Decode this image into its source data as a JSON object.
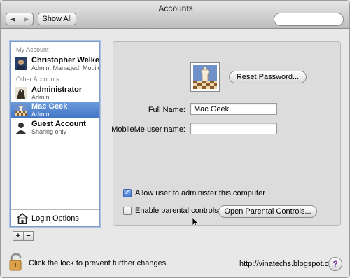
{
  "window": {
    "title": "Accounts"
  },
  "toolbar": {
    "back_icon": "◀",
    "forward_icon": "▶",
    "show_all_label": "Show All"
  },
  "sidebar": {
    "my_account_label": "My Account",
    "other_accounts_label": "Other Accounts",
    "accounts": [
      {
        "name": "Christopher Welker",
        "sub": "Admin, Managed, Mobile"
      },
      {
        "name": "Administrator",
        "sub": "Admin"
      },
      {
        "name": "Mac Geek",
        "sub": "Admin"
      },
      {
        "name": "Guest Account",
        "sub": "Sharing only"
      }
    ],
    "selected": "Mac Geek",
    "login_options_label": "Login Options",
    "add_label": "+",
    "remove_label": "−"
  },
  "panel": {
    "reset_password_label": "Reset Password...",
    "full_name_label": "Full Name:",
    "full_name_value": "Mac Geek",
    "mobileme_label": "MobileMe user name:",
    "mobileme_value": "",
    "allow_admin_label": "Allow user to administer this computer",
    "allow_admin_checked": true,
    "parental_label": "Enable parental controls",
    "parental_checked": false,
    "open_parental_label": "Open Parental Controls..."
  },
  "footer": {
    "lock_text": "Click the lock to prevent further changes.",
    "watermark": "http://vinatechs.blogspot.com",
    "help_label": "?"
  },
  "colors": {
    "selection": "#3f75c6",
    "accent_purple": "#7a3ea0"
  }
}
